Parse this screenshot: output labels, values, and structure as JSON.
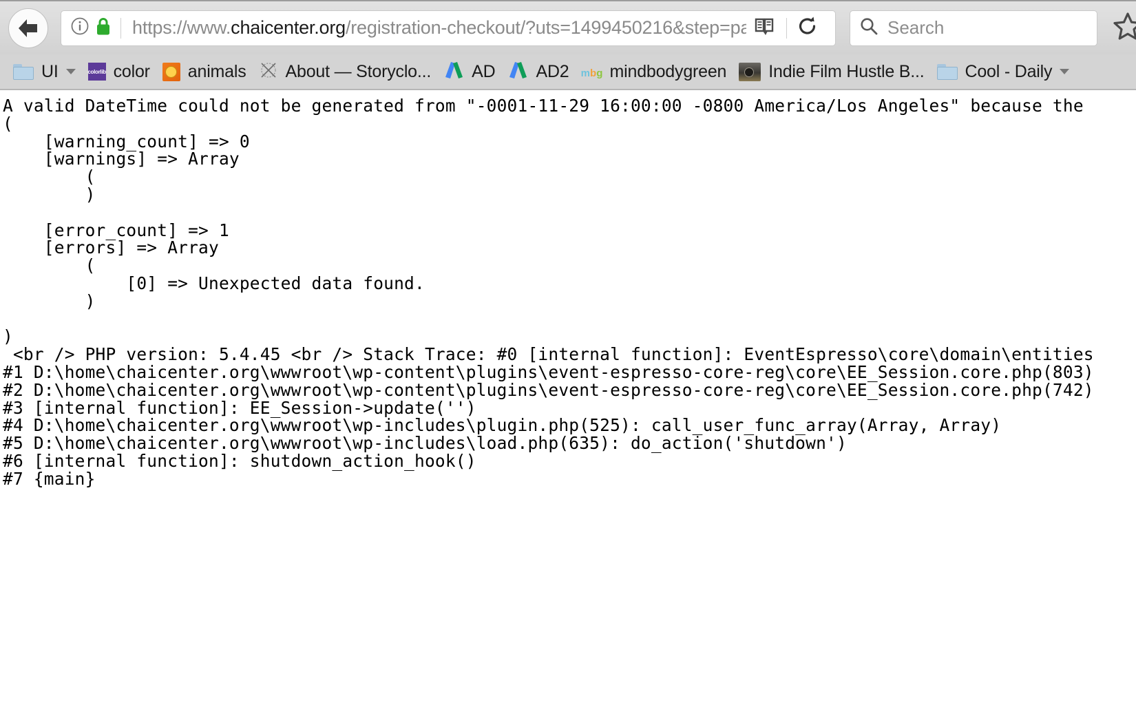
{
  "browser": {
    "back_button": "back-arrow",
    "url": {
      "prefix": "https://www.",
      "host": "chaicenter.org",
      "path": "/registration-checkout/?uts=1499450216&step=pa"
    },
    "icons": {
      "info": "info-icon",
      "lock": "lock-icon",
      "reader": "reader-view-icon",
      "reload": "reload-icon",
      "search": "search-icon",
      "star": "star-bookmark-icon"
    },
    "search": {
      "placeholder": "Search",
      "value": ""
    }
  },
  "bookmarks": [
    {
      "label": "UI",
      "icon": "folder-icon",
      "has_caret": true
    },
    {
      "label": "color",
      "icon": "colorlib-icon",
      "has_caret": false
    },
    {
      "label": "animals",
      "icon": "animals-icon",
      "has_caret": false
    },
    {
      "label": "About — Storyclo...",
      "icon": "storyclothing-icon",
      "has_caret": false
    },
    {
      "label": "AD",
      "icon": "google-ads-icon",
      "has_caret": false
    },
    {
      "label": "AD2",
      "icon": "google-ads-icon",
      "has_caret": false
    },
    {
      "label": "mindbodygreen",
      "icon": "mbg-icon",
      "has_caret": false
    },
    {
      "label": "Indie Film Hustle B...",
      "icon": "camera-icon",
      "has_caret": false
    },
    {
      "label": "Cool - Daily",
      "icon": "folder-icon",
      "has_caret": true
    }
  ],
  "error_dump": {
    "message_line": "A valid DateTime could not be generated from \"-0001-11-29 16:00:00 -0800 America/Los_Angeles\" because the",
    "array_block": "(\n    [warning_count] => 0\n    [warnings] => Array\n        (\n        )\n\n    [error_count] => 1\n    [errors] => Array\n        (\n            [0] => Unexpected data found.\n        )\n\n)",
    "trace_block": " <br /> PHP version: 5.4.45 <br /> Stack Trace: #0 [internal function]: EventEspresso\\core\\domain\\entities\n#1 D:\\home\\chaicenter.org\\wwwroot\\wp-content\\plugins\\event-espresso-core-reg\\core\\EE_Session.core.php(803)\n#2 D:\\home\\chaicenter.org\\wwwroot\\wp-content\\plugins\\event-espresso-core-reg\\core\\EE_Session.core.php(742)\n#3 [internal function]: EE_Session->update('')\n#4 D:\\home\\chaicenter.org\\wwwroot\\wp-includes\\plugin.php(525): call_user_func_array(Array, Array)\n#5 D:\\home\\chaicenter.org\\wwwroot\\wp-includes\\load.php(635): do_action('shutdown')\n#6 [internal function]: shutdown_action_hook()\n#7 {main}"
  },
  "colors": {
    "lock_green": "#2eab2e",
    "chrome_gray": "#d4d4d4",
    "url_text_gray": "#8a8a8a",
    "host_text": "#1b1b1b",
    "ads_blue": "#4285f4",
    "ads_green": "#0f9d58"
  }
}
